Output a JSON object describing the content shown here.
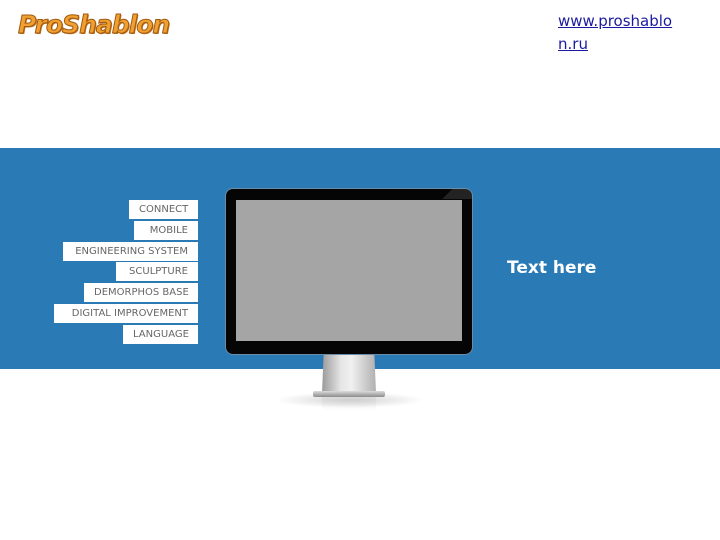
{
  "header": {
    "logo_text": "ProShablon",
    "site_link": "www.proshablon.ru"
  },
  "band": {
    "background_color": "#2a7ab6"
  },
  "menu": {
    "items": [
      {
        "label": "CONNECT"
      },
      {
        "label": "MOBILE"
      },
      {
        "label": "ENGINEERING SYSTEM"
      },
      {
        "label": "SCULPTURE"
      },
      {
        "label": "DEMORPHOS BASE"
      },
      {
        "label": "DIGITAL IMPROVEMENT"
      },
      {
        "label": "LANGUAGE"
      }
    ]
  },
  "monitor": {
    "screen_color": "#a5a5a5"
  },
  "caption": {
    "text": "Text here"
  }
}
